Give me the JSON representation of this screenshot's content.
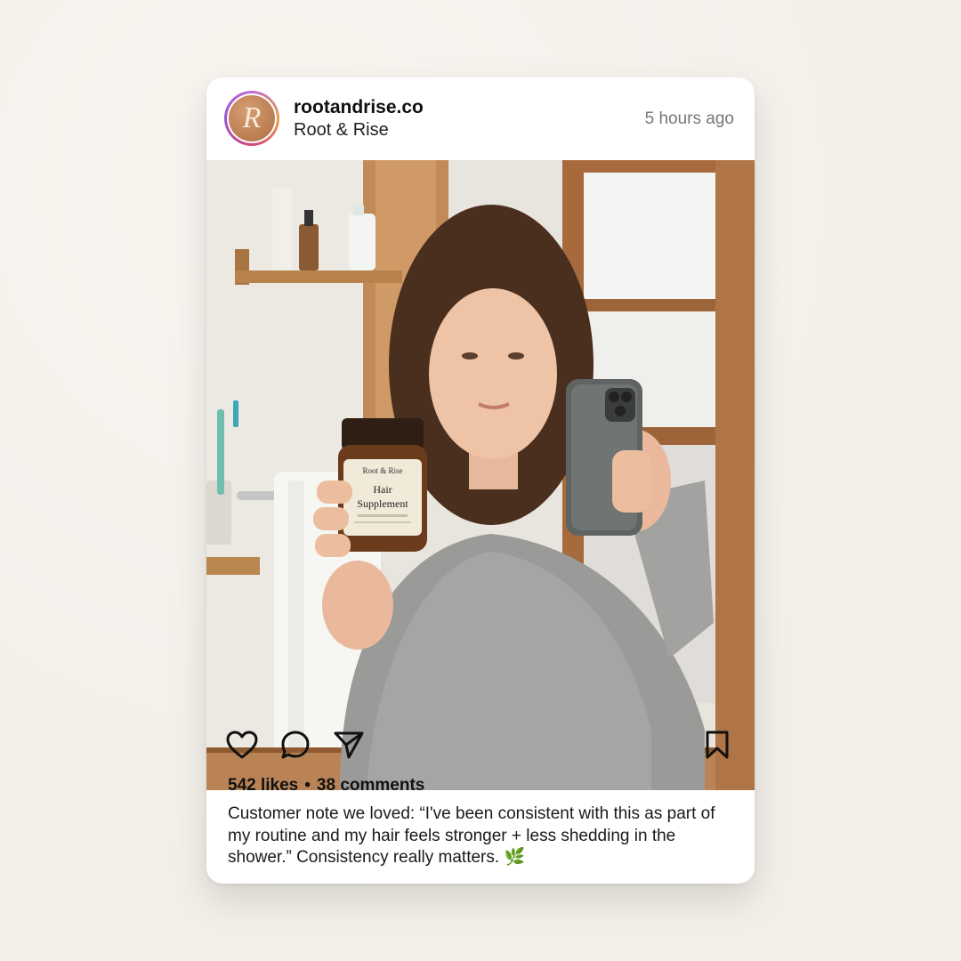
{
  "post": {
    "username": "rootandrise.co",
    "display_name": "Root & Rise",
    "avatar_letter": "R",
    "timestamp": "5 hours ago",
    "likes": "542 likes",
    "comments": "38 comments",
    "separator": "•",
    "caption": "Customer note we loved: “I've been consistent with this as part of my routine and my hair feels stronger + less shedding in the shower.” Consistency really matters. 🌿"
  },
  "photo": {
    "bottle_brand": "Root & Rise",
    "bottle_title_line1": "Hair",
    "bottle_title_line2": "Supplement"
  },
  "icons": {
    "like": "heart-icon",
    "comment": "comment-bubble-icon",
    "share": "paper-plane-icon",
    "save": "bookmark-icon"
  },
  "colors": {
    "brand": "#b9794d",
    "timestamp": "#777777"
  }
}
